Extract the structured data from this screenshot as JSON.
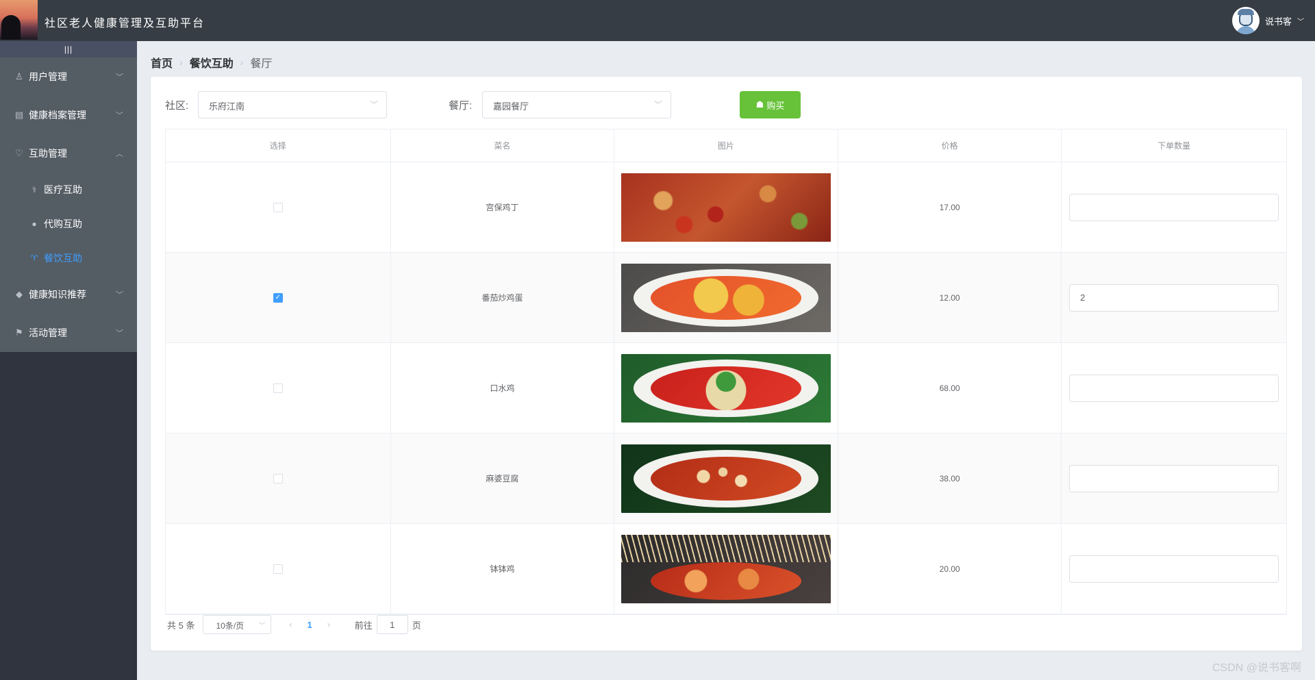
{
  "header": {
    "title": "社区老人健康管理及互助平台",
    "user_name": "说书客"
  },
  "sidebar": {
    "collapse_glyph": "|||",
    "items": [
      {
        "label": "用户管理",
        "icon": "user-icon"
      },
      {
        "label": "健康档案管理",
        "icon": "file-icon"
      },
      {
        "label": "互助管理",
        "icon": "heart-icon"
      },
      {
        "label": "健康知识推荐",
        "icon": "diamond-icon"
      },
      {
        "label": "活动管理",
        "icon": "flag-icon"
      }
    ],
    "sub_items": [
      {
        "label": "医疗互助",
        "icon": "medical-icon"
      },
      {
        "label": "代购互助",
        "icon": "shop-icon"
      },
      {
        "label": "餐饮互助",
        "icon": "dining-icon",
        "active": true
      }
    ]
  },
  "breadcrumb": {
    "home": "首页",
    "section": "餐饮互助",
    "current": "餐厅"
  },
  "filters": {
    "community_label": "社区:",
    "community_value": "乐府江南",
    "restaurant_label": "餐厅:",
    "restaurant_value": "嘉园餐厅",
    "buy_label": "购买"
  },
  "table": {
    "headers": [
      "选择",
      "菜名",
      "图片",
      "价格",
      "下单数量"
    ],
    "rows": [
      {
        "name": "宫保鸡丁",
        "price": "17.00",
        "checked": false,
        "qty": ""
      },
      {
        "name": "番茄炒鸡蛋",
        "price": "12.00",
        "checked": true,
        "qty": "2"
      },
      {
        "name": "口水鸡",
        "price": "68.00",
        "checked": false,
        "qty": ""
      },
      {
        "name": "麻婆豆腐",
        "price": "38.00",
        "checked": false,
        "qty": ""
      },
      {
        "name": "钵钵鸡",
        "price": "20.00",
        "checked": false,
        "qty": ""
      }
    ]
  },
  "pagination": {
    "total": "共 5 条",
    "page_size": "10条/页",
    "current_page": "1",
    "goto_label": "前往",
    "goto_value": "1",
    "page_suffix": "页"
  },
  "watermark": "CSDN @说书客啊",
  "colors": {
    "header_bg": "#363d44",
    "menu_bg": "#545c64",
    "active": "#409eff",
    "buy_button": "#67c23a"
  }
}
